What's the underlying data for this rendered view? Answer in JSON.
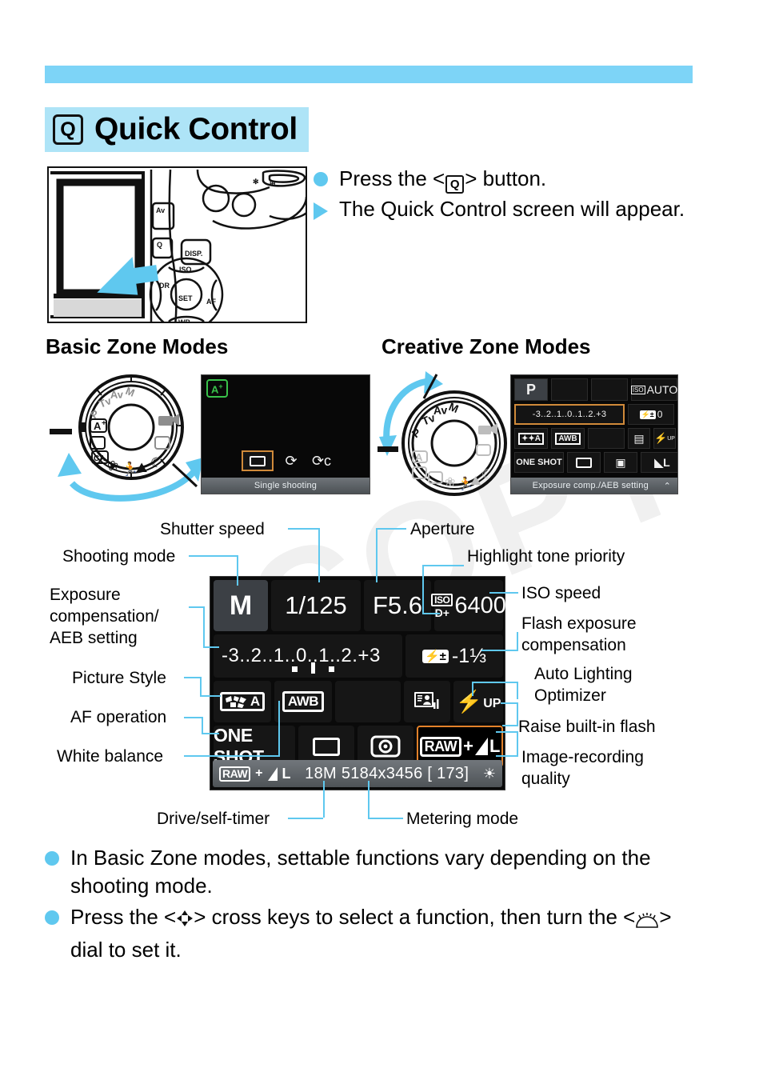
{
  "page": {
    "watermark": "COPY",
    "title": "Quick Control",
    "title_icon": "Q"
  },
  "intro": {
    "steps": [
      {
        "marker": "dot",
        "pre": "Press the <",
        "icon": "Q",
        "post": "> button."
      },
      {
        "marker": "triangle",
        "text": "The Quick Control screen will appear."
      }
    ]
  },
  "zones": {
    "basic_heading": "Basic Zone Modes",
    "creative_heading": "Creative Zone Modes"
  },
  "basic_lcd": {
    "mode_badge": "A",
    "mode_badge_sup": "+",
    "drive_options": [
      "single-shooting-icon",
      "self-timer-icon",
      "self-timer-continuous-icon"
    ],
    "footer": "Single shooting"
  },
  "creative_lcd": {
    "mode": "P",
    "iso_label": "ISO",
    "iso_value": "AUTO",
    "exposure_scale": "-3..2..1..0..1..2.+3",
    "flash_exp_comp": "0",
    "picture_style": "picture-style-auto-icon",
    "white_balance": "AWB",
    "auto_lighting_optimizer": "alo-icon",
    "flash": "UP",
    "af_operation": "ONE SHOT",
    "drive": "single-shooting-icon",
    "metering": "evaluative-metering-icon",
    "quality": "L",
    "footer": "Exposure comp./AEB setting",
    "footer_arrow": "dial-icon"
  },
  "main_lcd": {
    "shooting_mode": "M",
    "shutter_speed": "1/125",
    "aperture": "F5.6",
    "iso_label": "ISO",
    "highlight_tone_priority": "D+",
    "iso_speed": "6400",
    "exposure_scale": "-3..2..1..0..1..2.+3",
    "flash_exp_comp_value": "-1⅓",
    "flash_exp_comp_icon": "flash-comp-icon",
    "picture_style": "A",
    "picture_style_icon": "picture-style-icon",
    "white_balance": "AWB",
    "auto_lighting_optimizer_icon": "alo-icon",
    "flash_raise_label": "UP",
    "flash_raise_icon": "flash-bolt-icon",
    "af_operation": "ONE SHOT",
    "drive_mode_icon": "single-shooting-icon",
    "metering_mode_icon": "evaluative-metering-icon",
    "quality_raw": "RAW",
    "quality_plus": "+",
    "quality_large": "L",
    "footer": {
      "raw": "RAW",
      "plus": "+",
      "large": "L",
      "info": "18M 5184x3456 [  173]",
      "icon": "eye-level-icon"
    }
  },
  "callouts": {
    "shutter_speed": "Shutter speed",
    "shooting_mode": "Shooting mode",
    "exposure_comp": "Exposure\ncompensation/\nAEB setting",
    "picture_style": "Picture Style",
    "af_operation": "AF operation",
    "white_balance": "White balance",
    "aperture": "Aperture",
    "highlight_tone_priority": "Highlight tone priority",
    "iso_speed": "ISO speed",
    "flash_exposure_comp": "Flash exposure\ncompensation",
    "auto_lighting_optimizer": "Auto Lighting\nOptimizer",
    "raise_built_in_flash": "Raise built-in flash",
    "image_recording_quality": "Image-recording\nquality",
    "drive_self_timer": "Drive/self-timer",
    "metering_mode": "Metering mode"
  },
  "notes": [
    {
      "text": "In Basic Zone modes, settable functions vary depending on the shooting mode."
    },
    {
      "pre": "Press the <",
      "icon1": "cross-keys-icon",
      "mid": "> cross keys to select a function, then turn the <",
      "icon2": "main-dial-icon",
      "post": "> dial to set it."
    }
  ],
  "colors": {
    "accent_blue": "#5fc8ef",
    "band_blue": "#aee4f7",
    "rule_blue": "#7dd4f7",
    "selection_orange": "#e3812a",
    "lcd_bg": "#0a0a0a",
    "green_badge": "#39c24a"
  }
}
